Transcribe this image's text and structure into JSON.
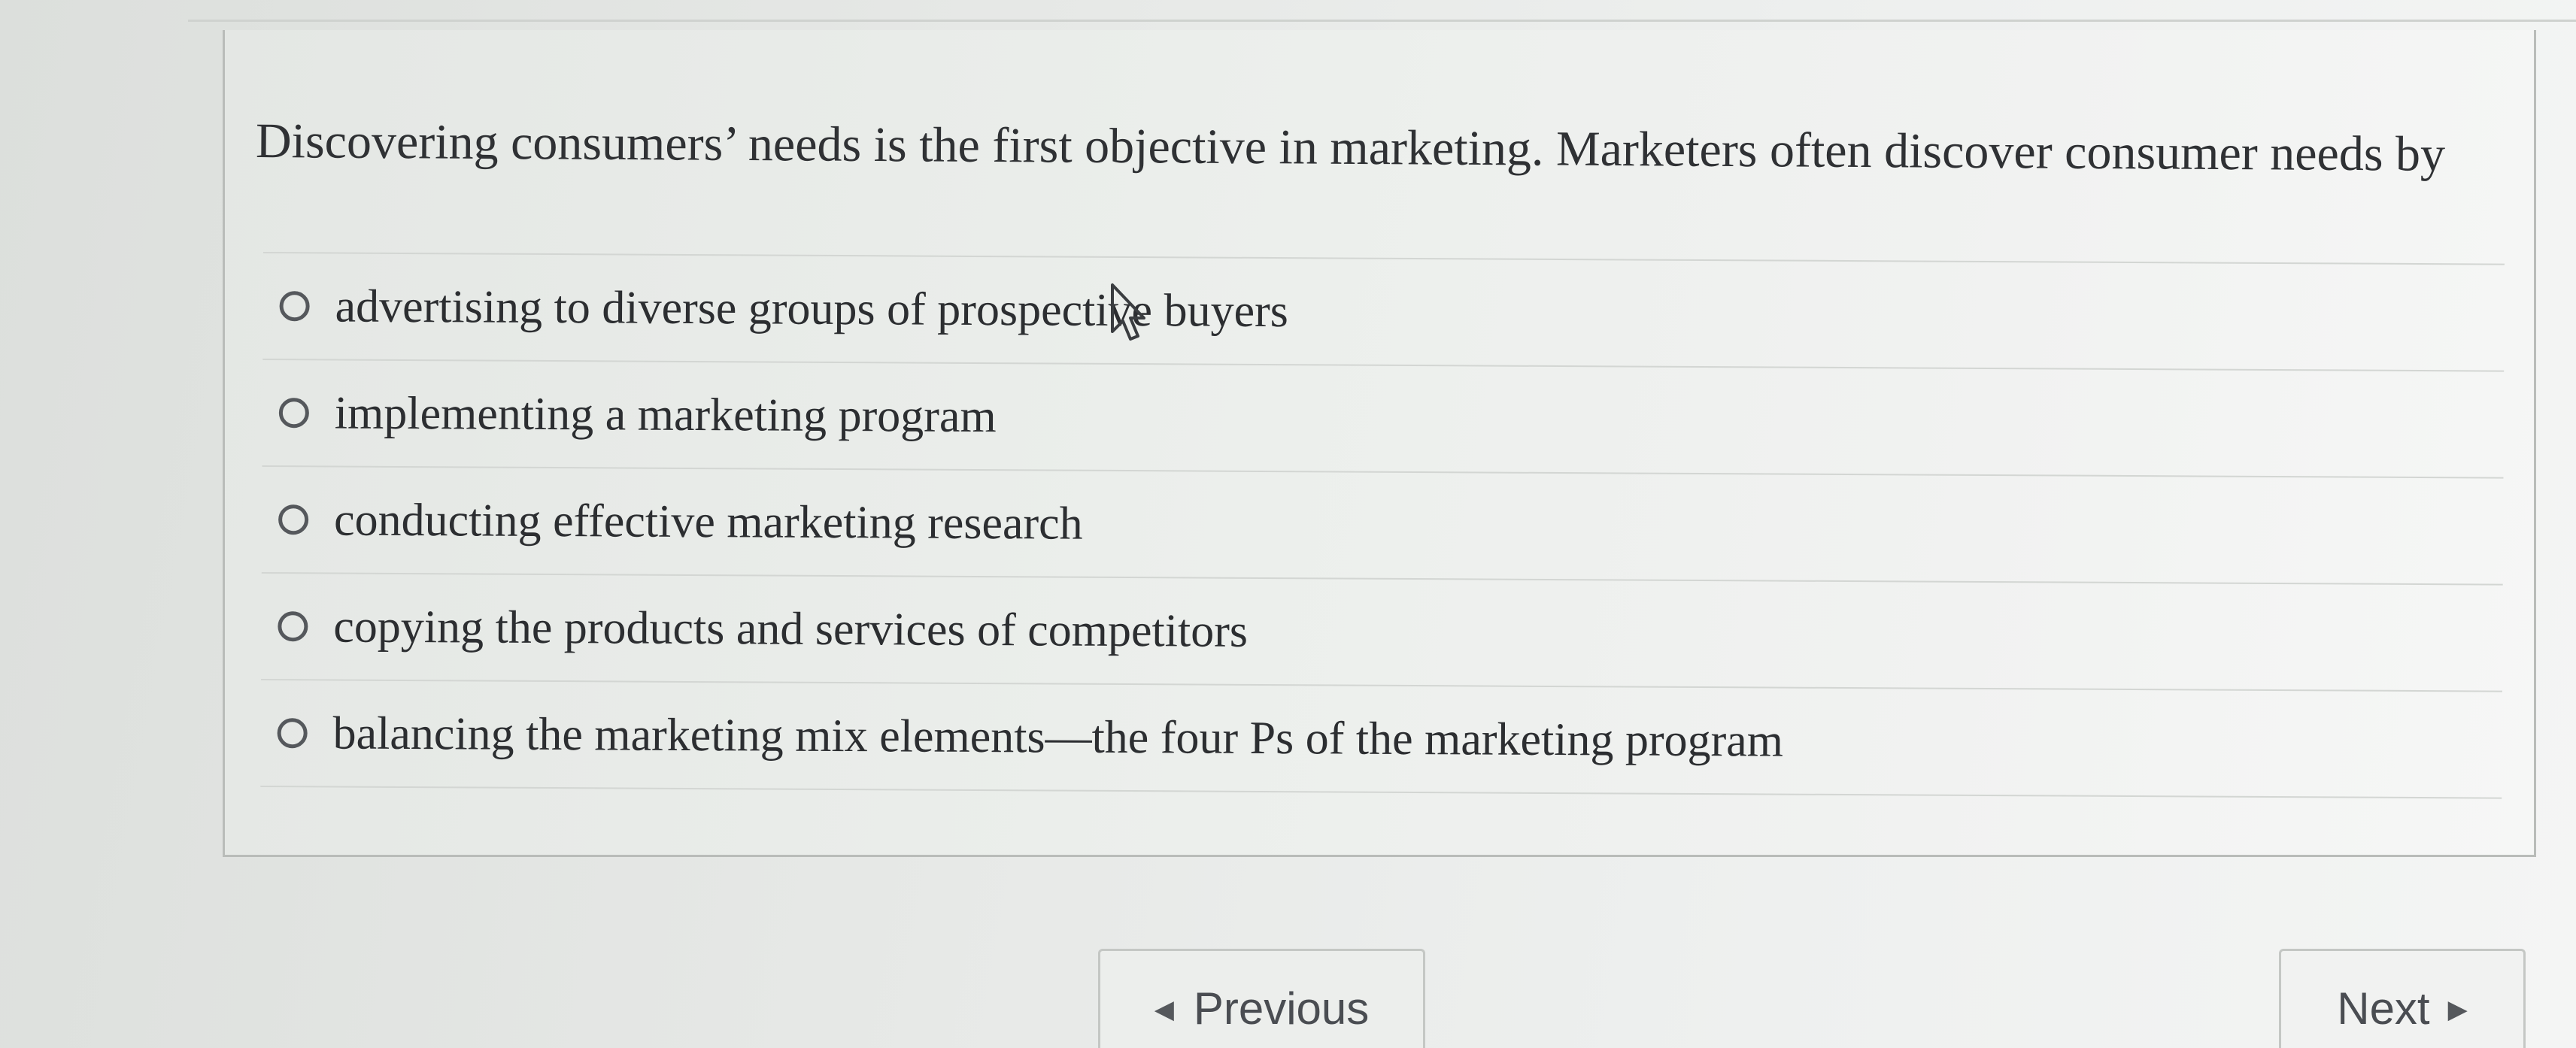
{
  "question": {
    "text": "Discovering consumers’ needs is the first objective in marketing. Marketers often discover consumer needs by"
  },
  "options": [
    {
      "label": "advertising to diverse groups of prospective buyers",
      "selected": false
    },
    {
      "label": "implementing a marketing program",
      "selected": false
    },
    {
      "label": "conducting effective marketing research",
      "selected": false
    },
    {
      "label": "copying the products and services of competitors",
      "selected": false
    },
    {
      "label": "balancing the marketing mix elements—the four Ps of the marketing program",
      "selected": false
    }
  ],
  "navigation": {
    "previous_label": "Previous",
    "next_label": "Next",
    "previous_icon": "triangle-left-icon",
    "next_icon": "triangle-right-icon"
  },
  "colors": {
    "text": "#2f3134",
    "border": "#b9bcb9",
    "radio": "#55585c"
  }
}
